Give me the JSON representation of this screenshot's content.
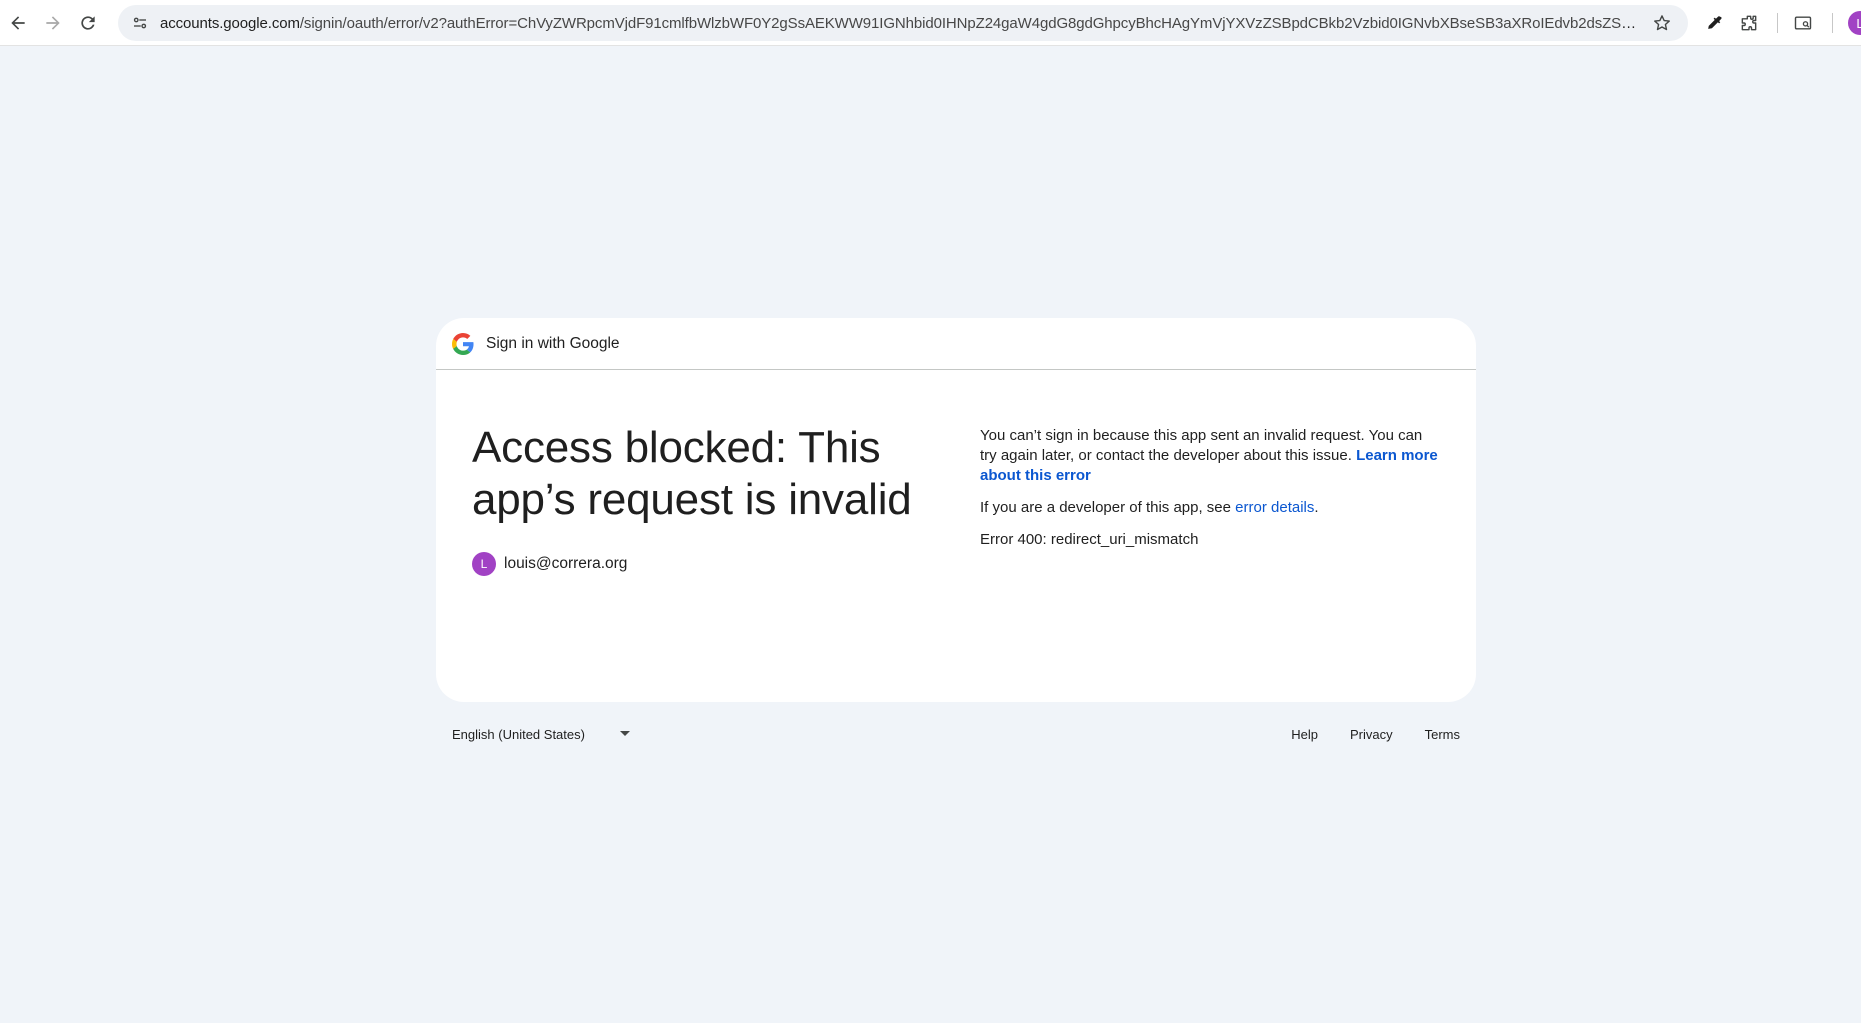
{
  "browser": {
    "url_host": "accounts.google.com",
    "url_path": "/signin/oauth/error/v2?authError=ChVyZWRpcmVjdF91cmlfbWlzbWF0Y2gSsAEKWW91IGNhbid0IHNpZ24gaW4gdG8gdGhpcyBhcHAgYmVjYXVzZSBpdCBkb2Vzbid0IGNvbXBseSB3aXRoIEdvb2dsZSdzIE9BdXRoIDIuMCBw...",
    "profile_initial": "L",
    "profile_color": "#a142c4"
  },
  "card": {
    "header_title": "Sign in with Google",
    "headline": "Access blocked: This app’s request is invalid",
    "account": {
      "initial": "L",
      "email": "louis@correra.org",
      "avatar_color": "#a142c4"
    },
    "message": {
      "intro": "You can’t sign in because this app sent an invalid request. You can try again later, or contact the developer about this issue. ",
      "learn_more": "Learn more about this error",
      "developer_prefix": "If you are a developer of this app, see ",
      "error_details": "error details",
      "developer_suffix": ".",
      "error_code": "Error 400: redirect_uri_mismatch"
    },
    "link_color": "#0b57d0"
  },
  "footer": {
    "language": "English (United States)",
    "links": [
      "Help",
      "Privacy",
      "Terms"
    ]
  }
}
